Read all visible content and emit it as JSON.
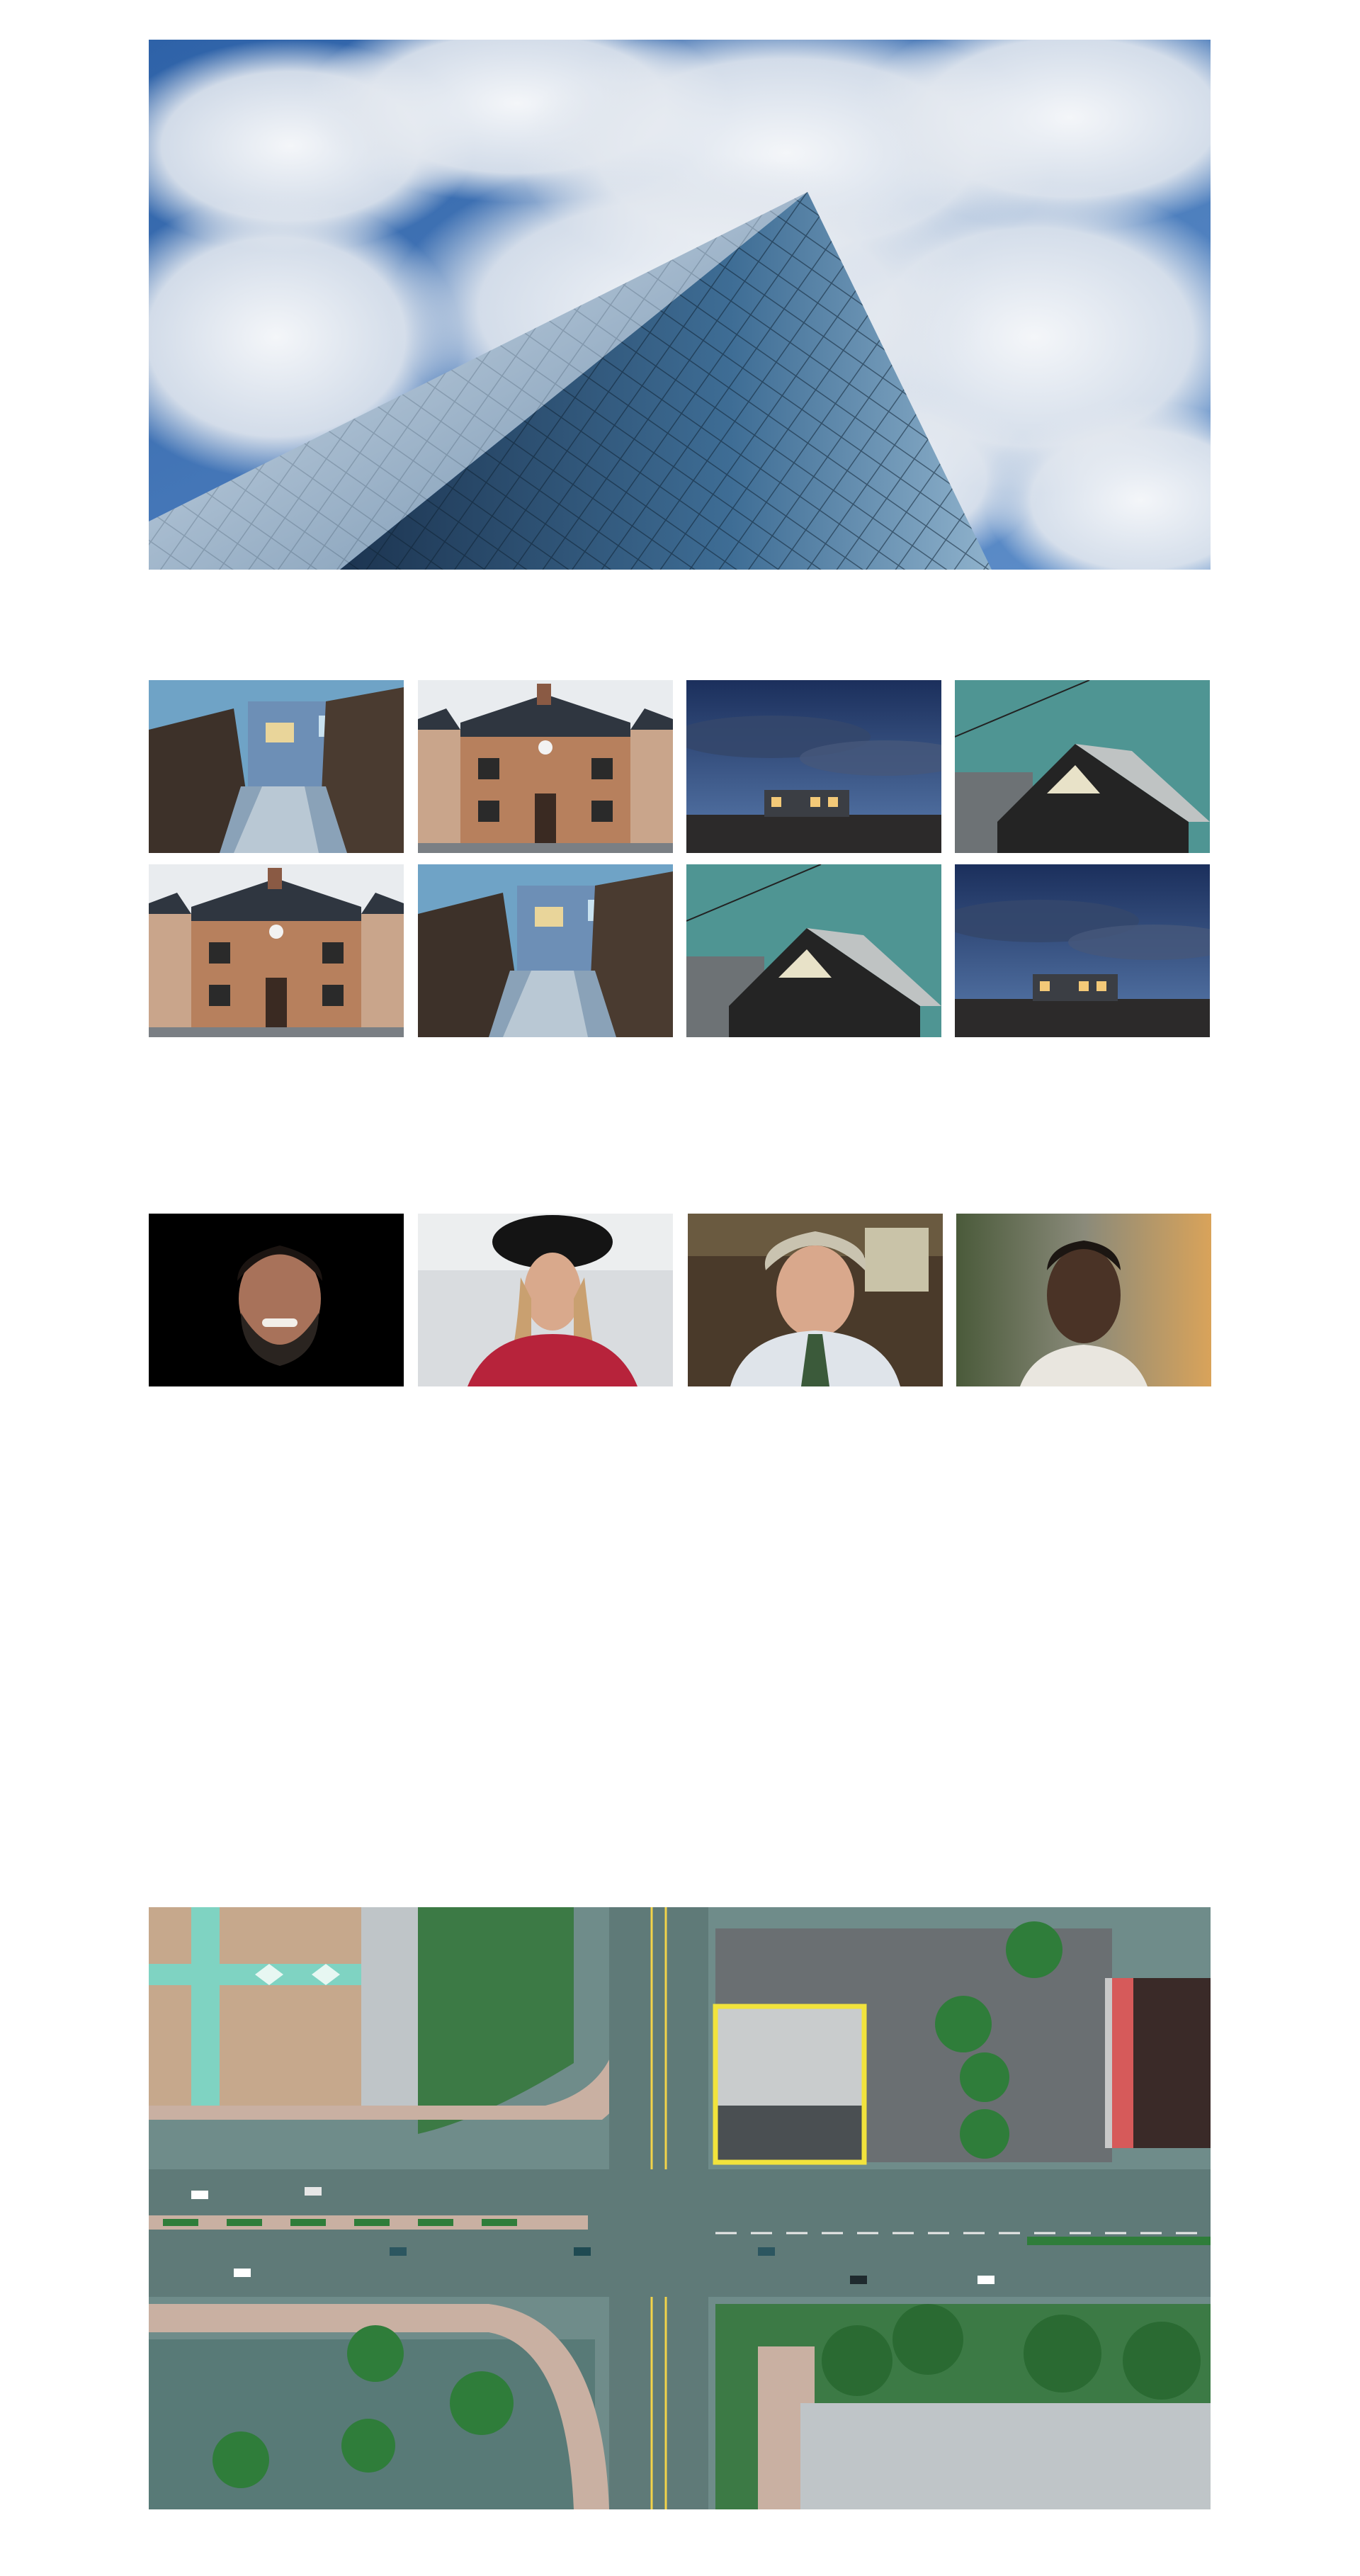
{
  "gallery": {
    "hero": {
      "icon": "glass-pyramid-building-image"
    },
    "houses": [
      {
        "icon": "blue-modern-house-image"
      },
      {
        "icon": "brick-house-image"
      },
      {
        "icon": "night-house-image"
      },
      {
        "icon": "dark-barn-house-image"
      },
      {
        "icon": "brick-house-image"
      },
      {
        "icon": "blue-modern-house-image"
      },
      {
        "icon": "dark-barn-house-image"
      },
      {
        "icon": "night-house-image"
      }
    ],
    "portraits": [
      {
        "icon": "smiling-bearded-man-image"
      },
      {
        "icon": "woman-in-hat-image"
      },
      {
        "icon": "older-man-tie-image"
      },
      {
        "icon": "young-man-portrait-image"
      }
    ],
    "aerial": {
      "icon": "aerial-city-intersection-image"
    }
  },
  "colors": {
    "sky_blue": "#3a6fb4",
    "cloud": "#eef1f5",
    "glass_dark": "#1f3a57",
    "teal_sky": "#4f9593",
    "night_sky": "#233a66",
    "brick": "#b07a5a",
    "road": "#6f8c8a",
    "tree": "#2f7d3a",
    "highlight_yellow": "#f2e33c"
  }
}
